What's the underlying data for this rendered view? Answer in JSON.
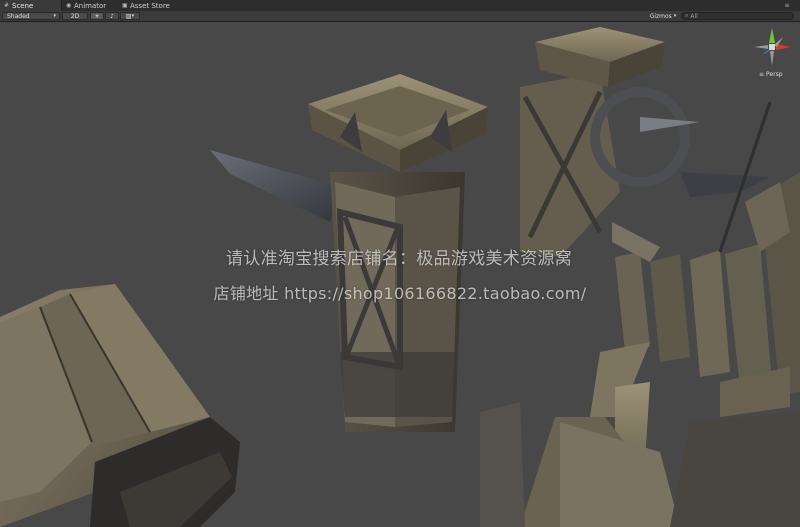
{
  "tabs": [
    {
      "label": "Scene",
      "icon": "scene-icon",
      "active": true
    },
    {
      "label": "Animator",
      "icon": "animator-icon",
      "active": false
    },
    {
      "label": "Asset Store",
      "icon": "asset-store-icon",
      "active": false
    }
  ],
  "toolbar": {
    "shading_mode": "Shaded",
    "mode_2d": "2D",
    "gizmos": "Gizmos",
    "search_placeholder": "All"
  },
  "scene": {
    "watermark_line1": "请认准淘宝搜索店铺名：极品游戏美术资源窝",
    "watermark_line2": "店铺地址 https://shop106166822.taobao.com/",
    "projection_label": "Persp"
  },
  "colors": {
    "editor_bg": "#474747",
    "tabbar_bg": "#2d2d2d",
    "gizmo_x": "#d33a2c",
    "gizmo_y": "#6fc73a",
    "gizmo_z": "#3c74d6"
  }
}
